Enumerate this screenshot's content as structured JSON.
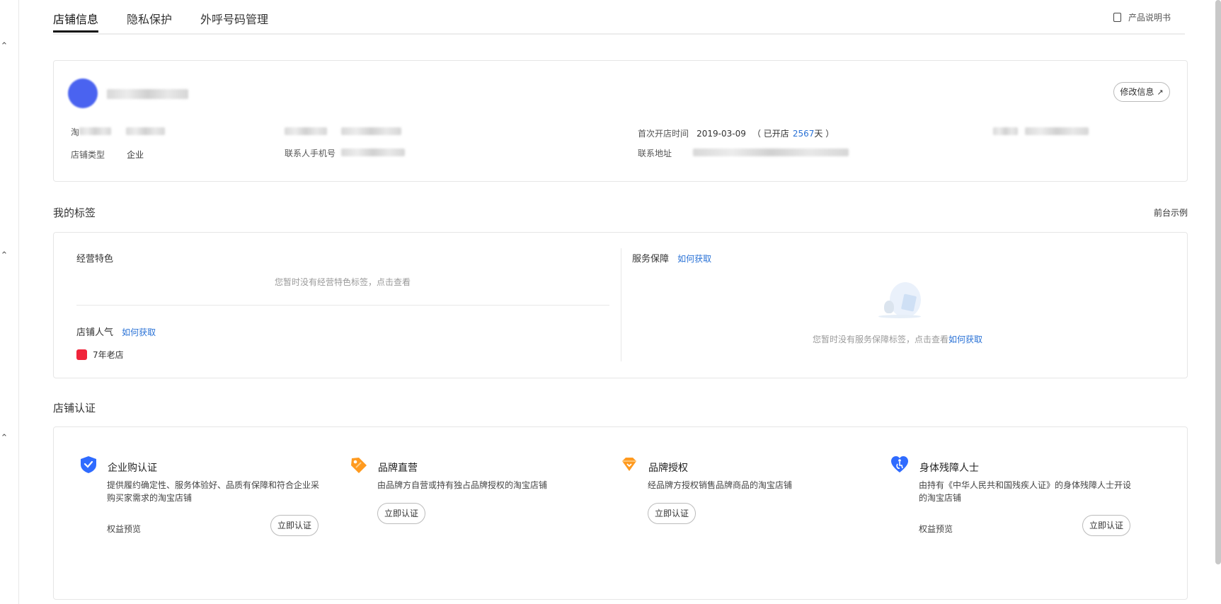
{
  "tabs": [
    {
      "label": "店铺信息"
    },
    {
      "label": "隐私保护"
    },
    {
      "label": "外呼号码管理"
    }
  ],
  "manual_label": "产品说明书",
  "shop_info": {
    "edit_label": "修改信息",
    "taobao_prefix": "淘",
    "shop_type_label": "店铺类型",
    "shop_type_value": "企业",
    "contact_label": "联系人手机号",
    "first_open_label": "首次开店时间",
    "first_open_date": "2019-03-09",
    "open_prefix": "（ 已开店",
    "open_days": "2567",
    "open_suffix": "天 ）",
    "address_label": "联系地址"
  },
  "tags": {
    "section_title": "我的标签",
    "preview_label": "前台示例",
    "features_title": "经营特色",
    "features_empty": "您暂时没有经营特色标签，点击查看",
    "popularity_title": "店铺人气",
    "how_to_get": "如何获取",
    "badge_label": "7年老店",
    "service_title": "服务保障",
    "service_empty": "您暂时没有服务保障标签，点击查看"
  },
  "certs": {
    "section_title": "店铺认证",
    "benefit_label": "权益预览",
    "apply_label": "立即认证",
    "items": [
      {
        "title": "企业购认证",
        "desc1": "提供履约确定性、服务体验好、品质有保障和符合企业采",
        "desc2": "购买家需求的淘宝店铺",
        "color": "#2f6bff"
      },
      {
        "title": "品牌直营",
        "desc1": "由品牌方自营或持有独占品牌授权的淘宝店铺",
        "desc2": "",
        "color": "#ff9a1f"
      },
      {
        "title": "品牌授权",
        "desc1": "经品牌方授权销售品牌商品的淘宝店铺",
        "desc2": "",
        "color": "#ff9a1f"
      },
      {
        "title": "身体残障人士",
        "desc1": "由持有《中华人民共和国残疾人证》的身体残障人士开设",
        "desc2": "的淘宝店铺",
        "color": "#2f6bff"
      }
    ]
  }
}
